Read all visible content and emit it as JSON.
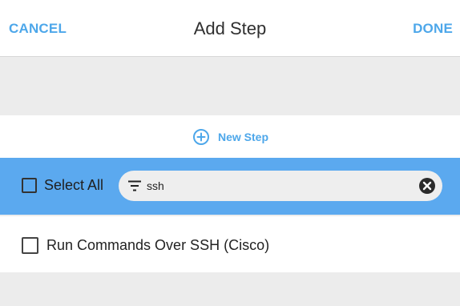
{
  "header": {
    "cancel_label": "CANCEL",
    "title": "Add Step",
    "done_label": "DONE"
  },
  "actions": {
    "new_step_label": "New Step"
  },
  "filter": {
    "select_all_label": "Select All",
    "search_value": "ssh"
  },
  "list": {
    "items": [
      {
        "label": "Run Commands Over SSH (Cisco)"
      }
    ]
  },
  "colors": {
    "accent": "#4da7ea",
    "filter_bar": "#5ba9ef",
    "background": "#ececec"
  },
  "icons": {
    "new_step": "plus-circle-icon",
    "filter": "filter-icon",
    "clear": "clear-circle-icon"
  }
}
